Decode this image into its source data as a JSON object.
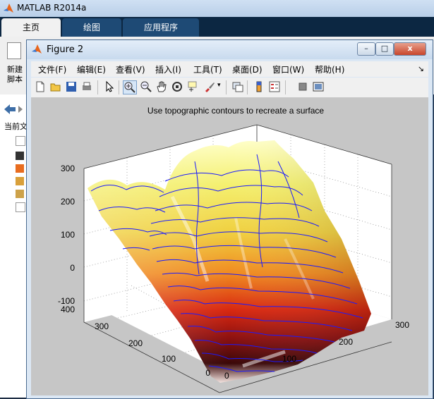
{
  "matlab": {
    "title": "MATLAB R2014a",
    "tabs": [
      "主页",
      "绘图",
      "应用程序"
    ],
    "toolstrip": {
      "new_script_label": "新建\n脚本"
    },
    "current_folder_label": "当前文"
  },
  "figure": {
    "title": "Figure 2",
    "window_buttons": {
      "minimize": "–",
      "maximize": "□",
      "close": "x"
    },
    "menus": [
      "文件(F)",
      "编辑(E)",
      "查看(V)",
      "插入(I)",
      "工具(T)",
      "桌面(D)",
      "窗口(W)",
      "帮助(H)"
    ],
    "menubar_arrow": "↘",
    "toolbar_icons": [
      "new-figure-icon",
      "open-file-icon",
      "save-icon",
      "print-icon",
      "pointer-icon",
      "zoom-in-icon",
      "zoom-out-icon",
      "pan-icon",
      "rotate-3d-icon",
      "data-cursor-icon",
      "brush-icon",
      "link-plot-icon",
      "colorbar-icon",
      "legend-icon",
      "hide-plot-tools-icon",
      "show-plot-tools-icon"
    ]
  },
  "chart_data": {
    "type": "surface",
    "title": "Use topographic contours to recreate a surface",
    "xlabel": "",
    "ylabel": "",
    "zlabel": "",
    "x_ticks": [
      "0",
      "100",
      "200",
      "300"
    ],
    "y_ticks": [
      "0",
      "100",
      "200",
      "300",
      "400"
    ],
    "z_ticks": [
      "-100",
      "0",
      "100",
      "200",
      "300"
    ],
    "xlim": [
      0,
      300
    ],
    "ylim": [
      0,
      400
    ],
    "zlim": [
      -100,
      300
    ],
    "grid": true,
    "colormap": "hot",
    "contour_color": "#1a1aff"
  }
}
